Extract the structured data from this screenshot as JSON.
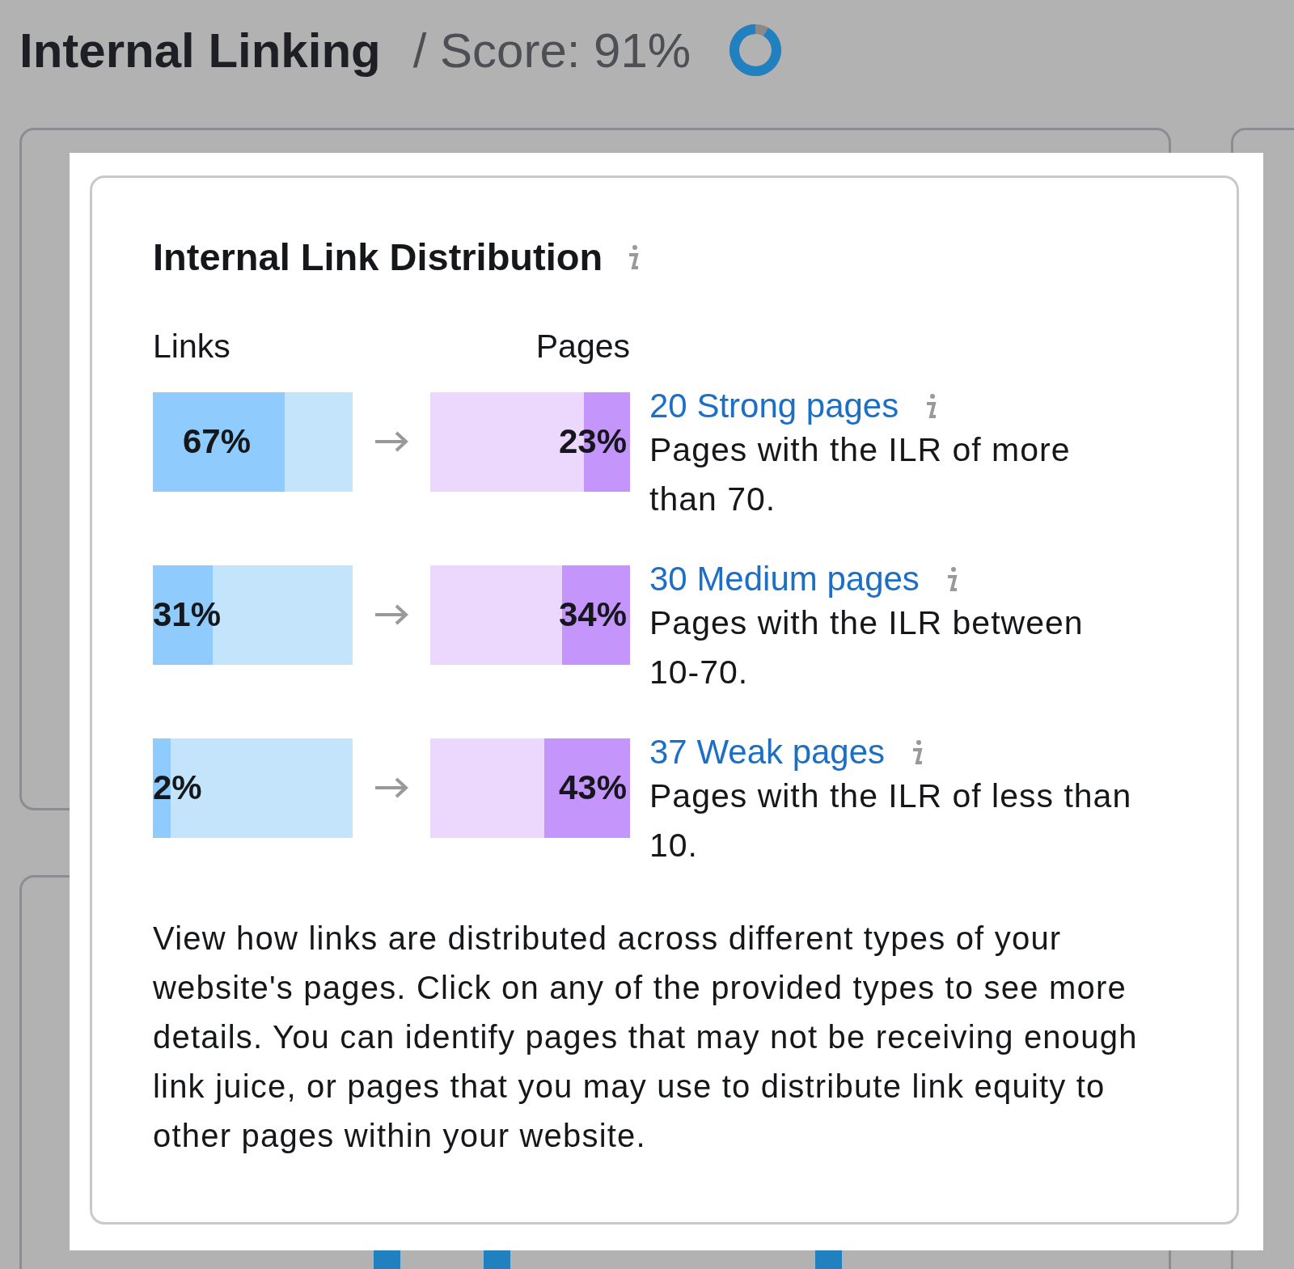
{
  "header": {
    "title": "Internal Linking",
    "score": {
      "text": "/ Score: 91%",
      "level": 0.91
    }
  },
  "modal": {
    "title": "Internal Link Distribution",
    "links_heading": "Links",
    "pages_heading": "Pages",
    "rows": [
      {
        "links": {
          "label": "67%",
          "level": 0.66
        },
        "pages": {
          "label": "23%",
          "level": 0.23
        },
        "link": "20 Strong pages",
        "description": "Pages with the ILR of more than 70."
      },
      {
        "links": {
          "label": "31%",
          "level": 0.3
        },
        "pages": {
          "label": "34%",
          "level": 0.34
        },
        "link": "30 Medium pages",
        "description": "Pages with the ILR between 10-70."
      },
      {
        "links": {
          "label": "2%",
          "level": 0.09
        },
        "pages": {
          "label": "43%",
          "level": 0.43
        },
        "link": "37 Weak pages",
        "description": "Pages with the ILR of less than 10."
      }
    ],
    "description": "View how links are distributed across different types of your website's pages. Click on any of the provided types to see more details. You can identify pages that may not be receiving enough link juice, or pages that you may use to distribute link equity to other pages within your website."
  }
}
